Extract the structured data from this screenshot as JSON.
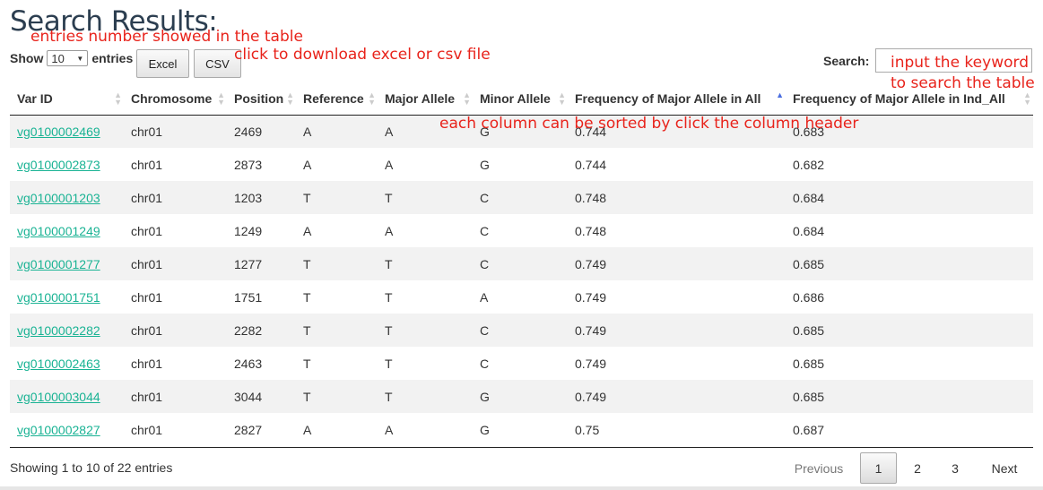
{
  "page": {
    "title": "Search Results:"
  },
  "annotations": {
    "entries": "entries number showed in the table",
    "download": "click to download excel or csv file",
    "keyword_line1": "input the keyword",
    "keyword_line2": "to search the table",
    "sort": "each column can be sorted by click the column header"
  },
  "length_control": {
    "show_label": "Show",
    "selected": "10",
    "entries_label": "entries"
  },
  "buttons": {
    "excel": "Excel",
    "csv": "CSV"
  },
  "search": {
    "label": "Search:",
    "value": ""
  },
  "table": {
    "columns": [
      "Var ID",
      "Chromosome",
      "Position",
      "Reference",
      "Major Allele",
      "Minor Allele",
      "Frequency of Major Allele in All",
      "Frequency of Major Allele in Ind_All"
    ],
    "sorted_column": "Frequency of Major Allele in All",
    "sort_direction": "ascending",
    "rows": [
      [
        "vg0100002469",
        "chr01",
        "2469",
        "A",
        "A",
        "G",
        "0.744",
        "0.683"
      ],
      [
        "vg0100002873",
        "chr01",
        "2873",
        "A",
        "A",
        "G",
        "0.744",
        "0.682"
      ],
      [
        "vg0100001203",
        "chr01",
        "1203",
        "T",
        "T",
        "C",
        "0.748",
        "0.684"
      ],
      [
        "vg0100001249",
        "chr01",
        "1249",
        "A",
        "A",
        "C",
        "0.748",
        "0.684"
      ],
      [
        "vg0100001277",
        "chr01",
        "1277",
        "T",
        "T",
        "C",
        "0.749",
        "0.685"
      ],
      [
        "vg0100001751",
        "chr01",
        "1751",
        "T",
        "T",
        "A",
        "0.749",
        "0.686"
      ],
      [
        "vg0100002282",
        "chr01",
        "2282",
        "T",
        "T",
        "C",
        "0.749",
        "0.685"
      ],
      [
        "vg0100002463",
        "chr01",
        "2463",
        "T",
        "T",
        "C",
        "0.749",
        "0.685"
      ],
      [
        "vg0100003044",
        "chr01",
        "3044",
        "T",
        "T",
        "G",
        "0.749",
        "0.685"
      ],
      [
        "vg0100002827",
        "chr01",
        "2827",
        "A",
        "A",
        "G",
        "0.75",
        "0.687"
      ]
    ]
  },
  "footer": {
    "info": "Showing 1 to 10 of 22 entries",
    "previous": "Previous",
    "pages": [
      "1",
      "2",
      "3"
    ],
    "current_page": "1",
    "next": "Next"
  },
  "colors": {
    "link": "#1ab394",
    "annotation": "#e8231b",
    "title": "#2c3e50"
  }
}
